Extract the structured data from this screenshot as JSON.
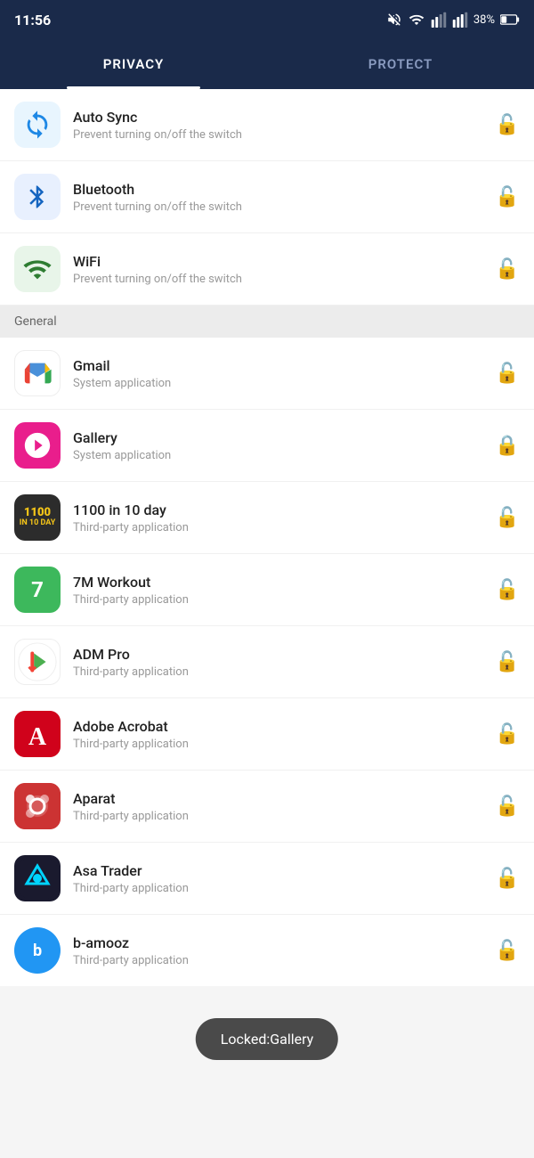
{
  "statusBar": {
    "time": "11:56",
    "battery": "38%"
  },
  "tabs": [
    {
      "label": "PRIVACY",
      "active": true
    },
    {
      "label": "PROTECT",
      "active": false
    }
  ],
  "topItems": [
    {
      "name": "Auto Sync",
      "subtitle": "Prevent turning on/off the switch",
      "icon": "autosync",
      "locked": false
    },
    {
      "name": "Bluetooth",
      "subtitle": "Prevent turning on/off the switch",
      "icon": "bluetooth",
      "locked": false
    },
    {
      "name": "WiFi",
      "subtitle": "Prevent turning on/off the switch",
      "icon": "wifi",
      "locked": false
    }
  ],
  "sectionLabel": "General",
  "appItems": [
    {
      "name": "Gmail",
      "subtitle": "System application",
      "icon": "gmail",
      "locked": false
    },
    {
      "name": "Gallery",
      "subtitle": "System application",
      "icon": "gallery",
      "locked": true
    },
    {
      "name": "1100 in 10 day",
      "subtitle": "Third-party application",
      "icon": "1100",
      "locked": false
    },
    {
      "name": "7M Workout",
      "subtitle": "Third-party application",
      "icon": "7m",
      "locked": false
    },
    {
      "name": "ADM Pro",
      "subtitle": "Third-party application",
      "icon": "adm",
      "locked": false
    },
    {
      "name": "Adobe Acrobat",
      "subtitle": "Third-party application",
      "icon": "adobe",
      "locked": false
    },
    {
      "name": "Aparat",
      "subtitle": "Third-party application",
      "icon": "aparat",
      "locked": false
    },
    {
      "name": "Asa Trader",
      "subtitle": "Third-party application",
      "icon": "asatrader",
      "locked": false
    },
    {
      "name": "b-amooz",
      "subtitle": "Third-party application",
      "icon": "bamooz",
      "locked": false
    }
  ],
  "toast": "Locked:Gallery",
  "icons": {
    "lock_open": "🔓",
    "lock_closed": "🔒"
  }
}
